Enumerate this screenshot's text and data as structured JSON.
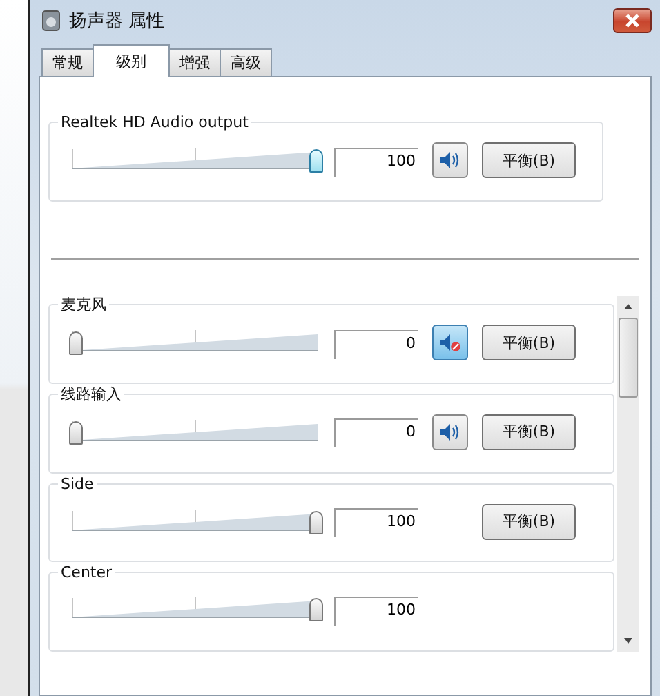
{
  "window": {
    "title": "扬声器 属性"
  },
  "tabs": [
    {
      "label": "常规",
      "selected": false
    },
    {
      "label": "级别",
      "selected": true
    },
    {
      "label": "增强",
      "selected": false
    },
    {
      "label": "高级",
      "selected": false
    }
  ],
  "master": {
    "name": "Realtek HD Audio output",
    "level": 1,
    "value": "100",
    "focused": true,
    "muted": false,
    "balance_button": "平衡(B)"
  },
  "channels": [
    {
      "name": "麦克风",
      "level": 0,
      "value": "0",
      "muted": true,
      "balance_button": "平衡(B)"
    },
    {
      "name": "线路输入",
      "level": 0,
      "value": "0",
      "muted": false,
      "balance_button": "平衡(B)"
    },
    {
      "name": "Side",
      "level": 1,
      "value": "100",
      "balance_button": "平衡(B)"
    },
    {
      "name": "Center",
      "level": 1,
      "value": "100"
    }
  ]
}
